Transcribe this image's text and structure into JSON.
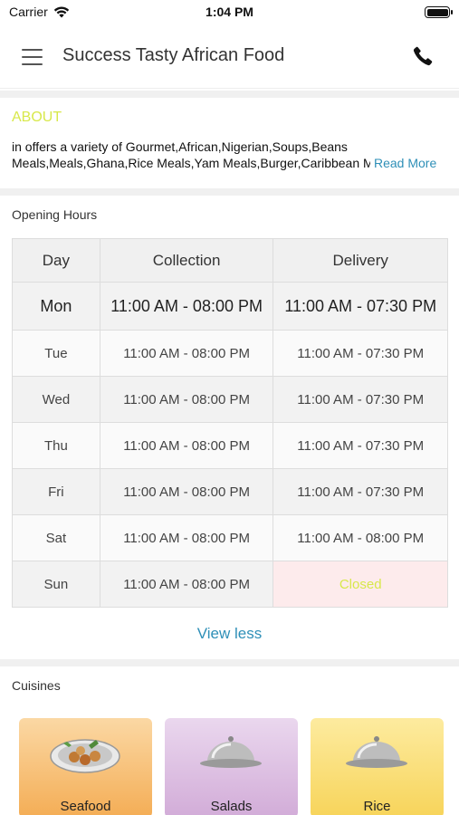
{
  "status_bar": {
    "carrier": "Carrier",
    "time": "1:04 PM"
  },
  "header": {
    "title": "Success Tasty African Food"
  },
  "about": {
    "heading": "ABOUT",
    "line1": "in  offers a variety of Gourmet,African,Nigerian,Soups,Beans",
    "line2": "Meals,Meals,Ghana,Rice Meals,Yam Meals,Burger,Caribbean M...",
    "read_more": "Read More"
  },
  "opening_hours": {
    "label": "Opening Hours",
    "columns": [
      "Day",
      "Collection",
      "Delivery"
    ],
    "rows": [
      {
        "day": "Mon",
        "collection": "11:00 AM - 08:00 PM",
        "delivery": "11:00 AM - 07:30 PM"
      },
      {
        "day": "Tue",
        "collection": "11:00 AM - 08:00 PM",
        "delivery": "11:00 AM - 07:30 PM"
      },
      {
        "day": "Wed",
        "collection": "11:00 AM - 08:00 PM",
        "delivery": "11:00 AM - 07:30 PM"
      },
      {
        "day": "Thu",
        "collection": "11:00 AM - 08:00 PM",
        "delivery": "11:00 AM - 07:30 PM"
      },
      {
        "day": "Fri",
        "collection": "11:00 AM - 08:00 PM",
        "delivery": "11:00 AM - 07:30 PM"
      },
      {
        "day": "Sat",
        "collection": "11:00 AM - 08:00 PM",
        "delivery": "11:00 AM - 08:00 PM"
      },
      {
        "day": "Sun",
        "collection": "11:00 AM - 08:00 PM",
        "delivery": "Closed"
      }
    ],
    "view_less": "View less"
  },
  "cuisines": {
    "label": "Cuisines",
    "items": [
      {
        "name": "Seafood",
        "color": "#f5b35b"
      },
      {
        "name": "Salads",
        "color": "#d9b3de"
      },
      {
        "name": "Rice",
        "color": "#f9dc5a"
      }
    ]
  },
  "colors": {
    "accent": "#2e8fb7",
    "about_heading": "#d8e84a",
    "closed_bg": "#fdebec"
  }
}
